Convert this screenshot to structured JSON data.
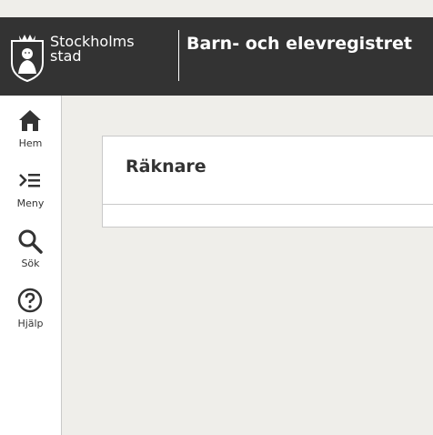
{
  "header": {
    "logo_line1": "Stockholms",
    "logo_line2": "stad",
    "app_title": "Barn- och elevregistret"
  },
  "sidebar": {
    "items": [
      {
        "label": "Hem",
        "icon": "home-icon"
      },
      {
        "label": "Meny",
        "icon": "menu-icon"
      },
      {
        "label": "Sök",
        "icon": "search-icon"
      },
      {
        "label": "Hjälp",
        "icon": "help-icon"
      }
    ]
  },
  "main": {
    "card_title": "Räknare"
  },
  "colors": {
    "header_bg": "#333333",
    "page_bg": "#efeeea",
    "text": "#333333",
    "border": "#c9c9c9"
  }
}
